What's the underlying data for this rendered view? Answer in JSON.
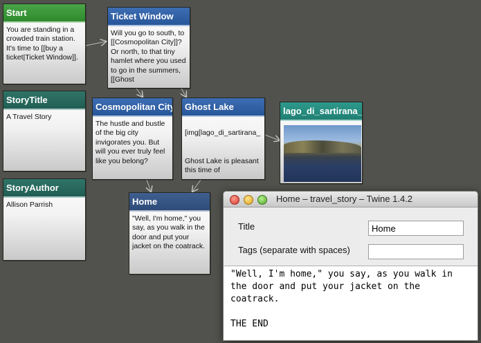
{
  "passages": {
    "start": {
      "title": "Start",
      "text": "You are standing in a crowded train station. It's time to [[buy a ticket|Ticket Window]]."
    },
    "ticket_window": {
      "title": "Ticket Window",
      "text": "Will you go to south, to [[Cosmopolitan City]]? Or north, to that tiny hamlet where you used to go in the summers, [[Ghost"
    },
    "story_title": {
      "title": "StoryTitle",
      "text": "A Travel Story"
    },
    "cosmopolitan_city": {
      "title": "Cosmopolitan City",
      "text": "The hustle and bustle of the big city invigorates you. But will you ever truly feel like you belong?"
    },
    "ghost_lake": {
      "title": "Ghost Lake",
      "text": "\n[img[lago_di_sartirana_\n\n\nGhost Lake is pleasant this time of"
    },
    "lago": {
      "title": "lago_di_sartirana_"
    },
    "story_author": {
      "title": "StoryAuthor",
      "text": "Allison Parrish"
    },
    "home": {
      "title": "Home",
      "text": "\"Well, I'm home,\" you say, as you walk in the door and put your jacket on the coatrack."
    }
  },
  "editor_window": {
    "title": "Home – travel_story – Twine 1.4.2",
    "title_label": "Title",
    "title_value": "Home",
    "tags_label": "Tags (separate with spaces)",
    "tags_value": "",
    "body_text": "\"Well, I'm home,\" you say, as you walk in\nthe door and put your jacket on the\ncoatrack.\n\nTHE END"
  }
}
